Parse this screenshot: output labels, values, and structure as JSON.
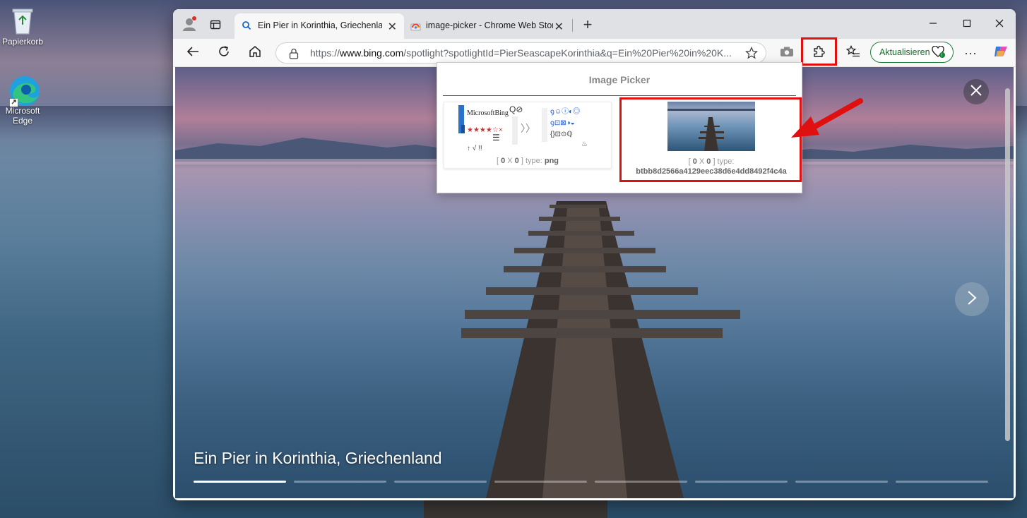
{
  "desktop": {
    "recycle_bin_label": "Papierkorb",
    "edge_label_line1": "Microsoft",
    "edge_label_line2": "Edge"
  },
  "tabs": [
    {
      "title": "Ein Pier in Korinthia, Griechenland",
      "active": true,
      "icon": "search-icon"
    },
    {
      "title": "image-picker - Chrome Web Store",
      "active": false,
      "icon": "chrome-web-store-icon"
    }
  ],
  "toolbar": {
    "url_prefix": "https://",
    "url_domain": "www.bing.com",
    "url_rest": "/spotlight?spotlightId=PierSeascapeKorinthia&q=Ein%20Pier%20in%20K...",
    "update_label": "Aktualisieren"
  },
  "popup": {
    "title": "Image Picker",
    "items": [
      {
        "dims_open": "[ ",
        "w": "0",
        "x": " X ",
        "h": "0",
        "dims_close": " ] type: ",
        "type": "png"
      },
      {
        "dims_open": "[ ",
        "w": "0",
        "x": " X ",
        "h": "0",
        "dims_close": " ] type:",
        "type": "btbb8d2566a4129eec38d6e4dd8492f4c4a"
      }
    ],
    "sprite_text": "MicrosoftBing"
  },
  "slide": {
    "caption": "Ein Pier in Korinthia, Griechenland",
    "progress_total": 8,
    "progress_active_index": 0
  },
  "colors": {
    "highlight": "#e01010",
    "update_green": "#1a7f37"
  }
}
